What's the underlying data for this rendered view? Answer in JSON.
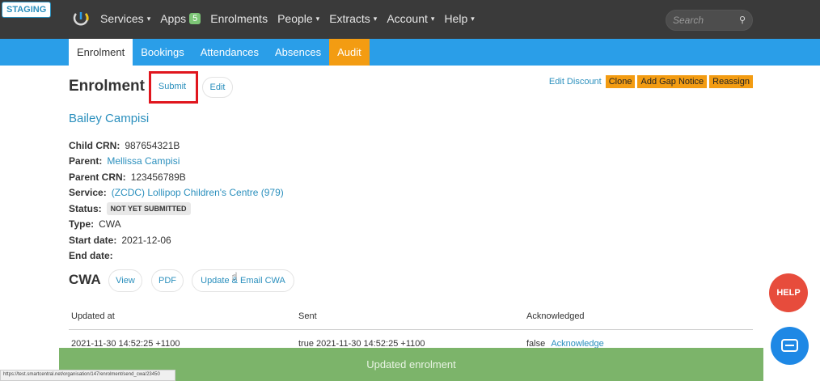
{
  "app": {
    "env_badge": "STAGING"
  },
  "nav": {
    "items": [
      {
        "label": "Services",
        "caret": "▾"
      },
      {
        "label": "Apps",
        "badge": "5"
      },
      {
        "label": "Enrolments"
      },
      {
        "label": "People",
        "caret": "▾"
      },
      {
        "label": "Extracts",
        "caret": "▾"
      },
      {
        "label": "Account",
        "caret": "▾"
      },
      {
        "label": "Help",
        "caret": "▾"
      }
    ],
    "search_placeholder": "Search"
  },
  "tabs": [
    {
      "label": "Enrolment"
    },
    {
      "label": "Bookings"
    },
    {
      "label": "Attendances"
    },
    {
      "label": "Absences"
    },
    {
      "label": "Audit"
    }
  ],
  "page": {
    "title": "Enrolment",
    "submit_label": "Submit",
    "edit_label": "Edit",
    "actions": {
      "edit_discount": "Edit Discount",
      "clone": "Clone",
      "add_gap_notice": "Add Gap Notice",
      "reassign": "Reassign"
    },
    "child_name": "Bailey Campisi"
  },
  "details": {
    "child_crn_label": "Child CRN:",
    "child_crn": "987654321B",
    "parent_label": "Parent:",
    "parent": "Mellissa Campisi",
    "parent_crn_label": "Parent CRN:",
    "parent_crn": "123456789B",
    "service_label": "Service:",
    "service": "(ZCDC) Lollipop Children's Centre (979)",
    "status_label": "Status:",
    "status": "NOT YET SUBMITTED",
    "type_label": "Type:",
    "type": "CWA",
    "start_date_label": "Start date:",
    "start_date": "2021-12-06",
    "end_date_label": "End date:",
    "end_date": ""
  },
  "cwa": {
    "title": "CWA",
    "view_label": "View",
    "pdf_label": "PDF",
    "update_label": "Update & Email CWA",
    "columns": [
      "Updated at",
      "Sent",
      "Acknowledged"
    ],
    "rows": [
      {
        "updated_at": "2021-11-30 14:52:25 +1100",
        "sent": "true 2021-11-30 14:52:25 +1100",
        "ack_value": "false",
        "ack_link": "Acknowledge"
      }
    ]
  },
  "toast": "Updated enrolment",
  "statusbar_url": "https://test.smartcentral.net/organisation/147/enrolment/send_cwa/23450",
  "help_label": "HELP",
  "colors": {
    "navbar": "#3a3a3a",
    "tabbar": "#2a9ee8",
    "audit_tab": "#f39c12",
    "link": "#2a8fbd",
    "toast": "#7cb46a",
    "help": "#e74c3c",
    "highlight": "#e0161e"
  }
}
